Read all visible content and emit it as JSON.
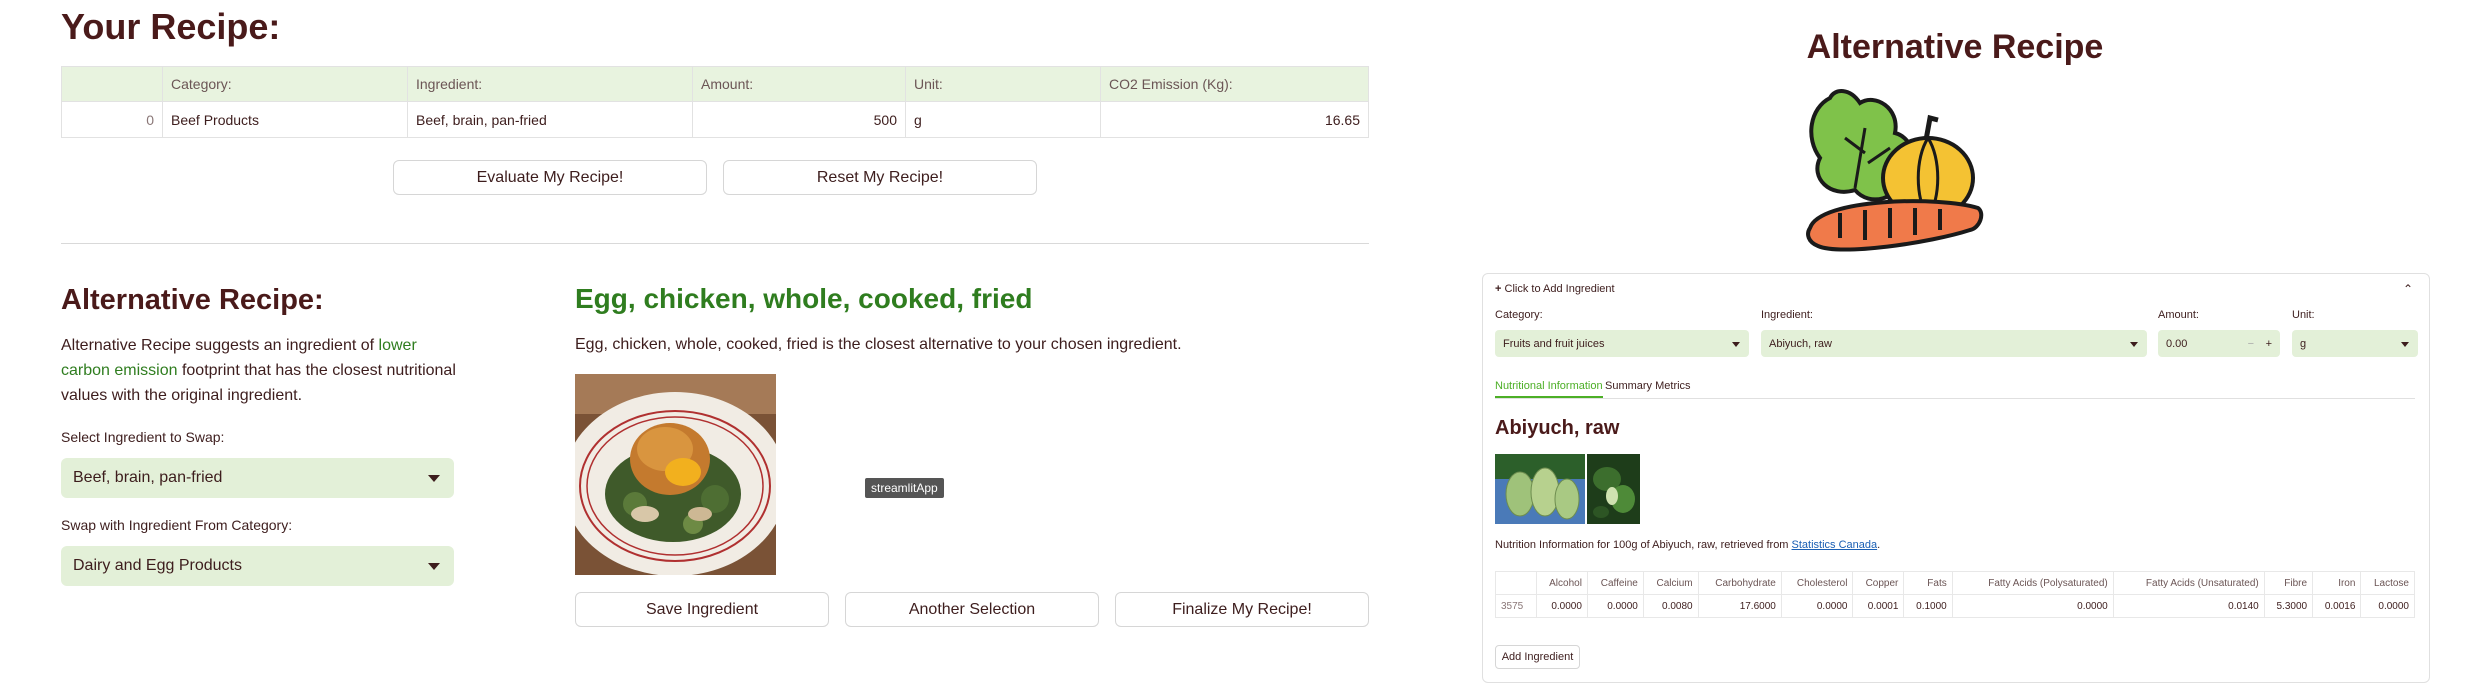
{
  "recipe": {
    "title": "Your Recipe:",
    "columns": [
      "",
      "Category:",
      "Ingredient:",
      "Amount:",
      "Unit:",
      "CO2 Emission (Kg):"
    ],
    "rows": [
      {
        "index": "0",
        "category": "Beef Products",
        "ingredient": "Beef, brain, pan-fried",
        "amount": "500",
        "unit": "g",
        "co2": "16.65"
      }
    ],
    "evaluate_label": "Evaluate My Recipe!",
    "reset_label": "Reset My Recipe!"
  },
  "alternative": {
    "heading": "Alternative Recipe:",
    "desc_part1": "Alternative Recipe suggests an ingredient of ",
    "desc_highlight": "lower carbon emission",
    "desc_part2": " footprint that has the closest nutritional values with the original ingredient.",
    "swap_label": "Select Ingredient to Swap:",
    "swap_value": "Beef, brain, pan-fried",
    "category_label": "Swap with Ingredient From Category:",
    "category_value": "Dairy and Egg Products",
    "result_name": "Egg, chicken, whole, cooked, fried",
    "result_sub": "Egg, chicken, whole, cooked, fried is the closest alternative to your chosen ingredient.",
    "tooltip": "streamlitApp",
    "save_label": "Save Ingredient",
    "another_label": "Another Selection",
    "finalize_label": "Finalize My Recipe!"
  },
  "sidebar": {
    "title": "Alternative Recipe",
    "expander_label": "Click to Add Ingredient",
    "category_label": "Category:",
    "category_value": "Fruits and fruit juices",
    "ingredient_label": "Ingredient:",
    "ingredient_value": "Abiyuch, raw",
    "amount_label": "Amount:",
    "amount_value": "0.00",
    "unit_label": "Unit:",
    "unit_value": "g",
    "tab_nutrition": "Nutritional Information",
    "tab_summary": "Summary Metrics",
    "food_title": "Abiyuch, raw",
    "nutrition_text": "Nutrition Information for 100g of Abiyuch, raw, retrieved from ",
    "source_link": "Statistics Canada",
    "source_suffix": ".",
    "nutrition_columns": [
      "",
      "Alcohol",
      "Caffeine",
      "Calcium",
      "Carbohydrate",
      "Cholesterol",
      "Copper",
      "Fats",
      "Fatty Acids (Polysaturated)",
      "Fatty Acids (Unsaturated)",
      "Fibre",
      "Iron",
      "Lactose"
    ],
    "nutrition_row": [
      "3575",
      "0.0000",
      "0.0000",
      "0.0080",
      "17.6000",
      "0.0000",
      "0.0001",
      "0.1000",
      "0.0000",
      "0.0140",
      "5.3000",
      "0.0016",
      "0.0000"
    ],
    "add_label": "Add Ingredient"
  },
  "colors": {
    "maroon": "#4a1a1a",
    "accent_green": "#2f7d1f",
    "select_bg": "#e3f0d8",
    "header_bg": "#e8f3df"
  }
}
